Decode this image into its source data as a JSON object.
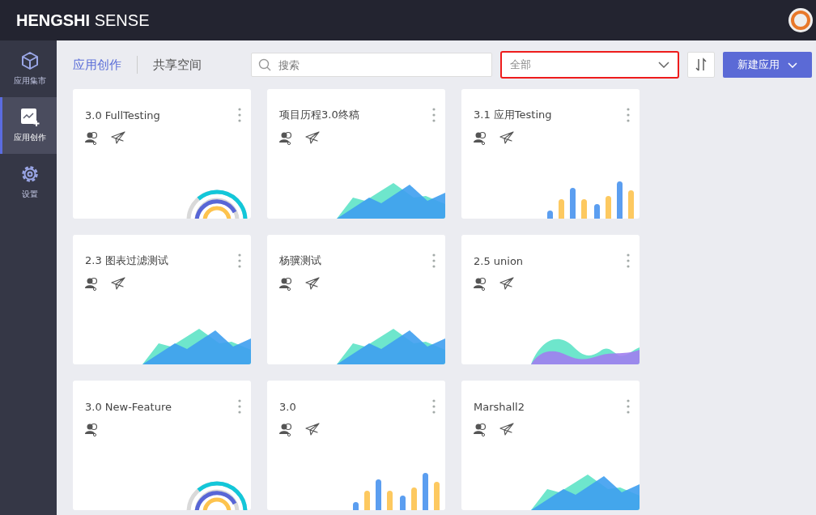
{
  "header": {
    "brand_bold": "HENGSHI",
    "brand_light": "SENSE"
  },
  "sidebar": {
    "items": [
      {
        "label": "应用集市",
        "kind": "market",
        "selected": false
      },
      {
        "label": "应用创作",
        "kind": "create",
        "selected": true
      },
      {
        "label": "设置",
        "kind": "settings",
        "selected": false
      }
    ]
  },
  "tabs": [
    {
      "label": "应用创作",
      "selected": true
    },
    {
      "label": "共享空间",
      "selected": false
    }
  ],
  "search": {
    "placeholder": "搜索"
  },
  "filter": {
    "value": "全部"
  },
  "new_button": {
    "label": "新建应用"
  },
  "apps": [
    {
      "title": "3.0 FullTesting",
      "kind": "rings",
      "published": true
    },
    {
      "title": "项目历程3.0终稿",
      "kind": "mountains",
      "published": true
    },
    {
      "title": "3.1 应用Testing",
      "kind": "bars",
      "published": true
    },
    {
      "title": "2.3 图表过滤测试",
      "kind": "mountains",
      "published": true
    },
    {
      "title": "杨骥测试",
      "kind": "mountains",
      "published": true
    },
    {
      "title": "2.5 union",
      "kind": "waves",
      "published": true
    },
    {
      "title": "3.0 New-Feature",
      "kind": "rings",
      "published": false
    },
    {
      "title": "3.0",
      "kind": "bars",
      "published": true
    },
    {
      "title": "Marshall2",
      "kind": "mountains",
      "published": true
    }
  ]
}
